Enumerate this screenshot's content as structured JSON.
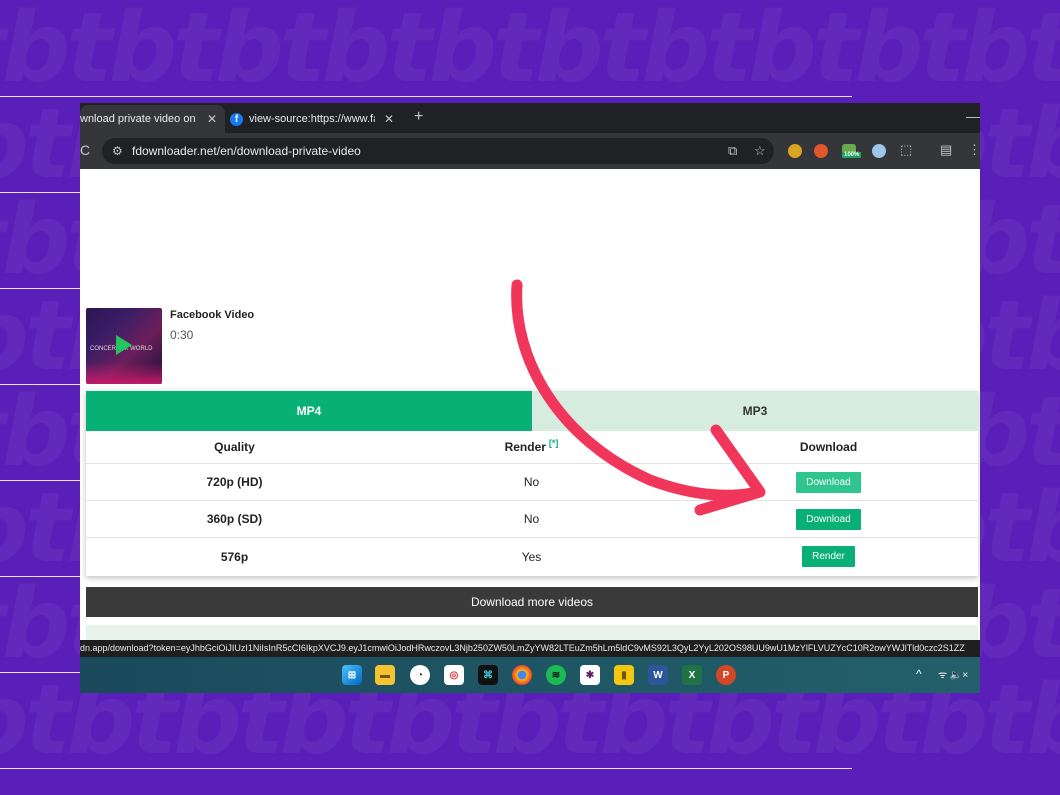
{
  "browser": {
    "tabs": [
      {
        "label": "wnload private video on Face",
        "close": "✕"
      },
      {
        "label": "view-source:https://www.facebo",
        "close": "✕"
      }
    ],
    "new_tab": "+",
    "minimize": "—",
    "reload": "C",
    "url": "fdownloader.net/en/download-private-video",
    "status_url": "dn.app/download?token=eyJhbGciOiJIUzI1NiIsInR5cCI6IkpXVCJ9.eyJ1cmwiOiJodHRwczovL3Njb250ZW50LmZyYW82LTEuZm5hLm5ldC9vMS92L3QyL2YyL202OS98UU9wU1MzYlFLVUZYcC10R2owYWJlTld0czc2S1ZZ"
  },
  "video": {
    "title": "Facebook Video",
    "duration": "0:30",
    "thumb_caption": "CONCERT 4K WORLD"
  },
  "download": {
    "tabs": {
      "mp4": "MP4",
      "mp3": "MP3"
    },
    "headers": {
      "quality": "Quality",
      "render": "Render",
      "render_note": "[*]",
      "download": "Download"
    },
    "rows": [
      {
        "quality": "720p (HD)",
        "render": "No",
        "action": "Download"
      },
      {
        "quality": "360p (SD)",
        "render": "No",
        "action": "Download"
      },
      {
        "quality": "576p",
        "render": "Yes",
        "action": "Render"
      }
    ],
    "more_videos": "Download more videos"
  },
  "taskbar": {
    "tray_chevron": "^",
    "tray_icons": "ᯤ  🔈×"
  },
  "colors": {
    "accent": "#09b076",
    "annotation_arrow": "#f0365a",
    "background": "#5a1fb8"
  }
}
